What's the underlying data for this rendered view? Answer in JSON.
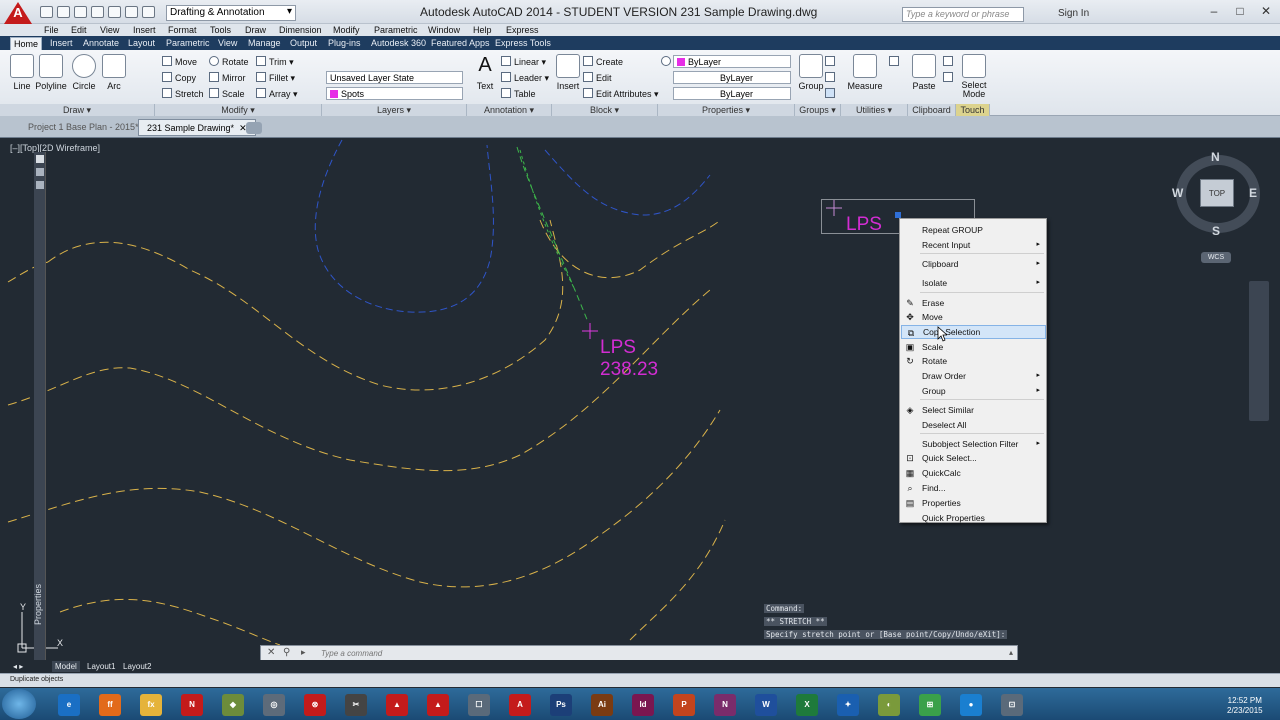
{
  "title_bar": {
    "app_logo": "A",
    "workspace": "Drafting & Annotation",
    "title": "Autodesk AutoCAD 2014 - STUDENT VERSION     231 Sample Drawing.dwg",
    "search_placeholder": "Type a keyword or phrase",
    "signin": "Sign In",
    "minimize": "–",
    "maximize": "□",
    "close": "✕"
  },
  "menu_bar": [
    "File",
    "Edit",
    "View",
    "Insert",
    "Format",
    "Tools",
    "Draw",
    "Dimension",
    "Modify",
    "Parametric",
    "Window",
    "Help",
    "Express"
  ],
  "ribbon_tabs": [
    "Home",
    "Insert",
    "Annotate",
    "Layout",
    "Parametric",
    "View",
    "Manage",
    "Output",
    "Plug-ins",
    "Autodesk 360",
    "Featured Apps",
    "Express Tools"
  ],
  "ribbon": {
    "draw": {
      "tools": [
        "Line",
        "Polyline",
        "Circle",
        "Arc"
      ],
      "title": "Draw"
    },
    "modify": {
      "tools": [
        "Move",
        "Copy",
        "Stretch",
        "Rotate",
        "Mirror",
        "Scale",
        "Trim",
        "Fillet",
        "Array"
      ],
      "title": "Modify"
    },
    "layers": {
      "state": "Unsaved Layer State",
      "layer": "Spots",
      "title": "Layers"
    },
    "annotation": {
      "big": "Text",
      "tools": [
        "Linear",
        "Leader",
        "Table"
      ],
      "title": "Annotation"
    },
    "block": {
      "big": "Insert",
      "tools": [
        "Create",
        "Edit",
        "Edit Attributes"
      ],
      "title": "Block"
    },
    "properties": {
      "color": "ByLayer",
      "linetype": "ByLayer",
      "lineweight": "ByLayer",
      "title": "Properties"
    },
    "groups": {
      "big": "Group",
      "title": "Groups"
    },
    "utilities": {
      "big": "Measure",
      "title": "Utilities"
    },
    "clipboard": {
      "big": "Paste",
      "title": "Clipboard"
    },
    "touch": {
      "big": "Select Mode",
      "title": "Touch"
    }
  },
  "file_tabs": [
    "Project 1 Base Plan - 2015*",
    "231 Sample Drawing*"
  ],
  "viewport_label": "[–][Top][2D Wireframe]",
  "palette_label": "Properties",
  "drawing": {
    "label_name": "LPS",
    "label_value": "238.23",
    "selected_label": "LPS"
  },
  "viewcube": {
    "north": "N",
    "south": "S",
    "east": "E",
    "west": "W",
    "top": "TOP",
    "wcs": "WCS"
  },
  "context_menu": [
    {
      "label": "Repeat GROUP",
      "submenu": false,
      "icon": ""
    },
    {
      "label": "Recent Input",
      "submenu": true,
      "icon": ""
    },
    {
      "label": "Clipboard",
      "submenu": true,
      "icon": ""
    },
    {
      "label": "Isolate",
      "submenu": true,
      "icon": ""
    },
    {
      "label": "Erase",
      "submenu": false,
      "icon": "eraser-icon"
    },
    {
      "label": "Move",
      "submenu": false,
      "icon": "move-icon"
    },
    {
      "label": "Copy Selection",
      "submenu": false,
      "icon": "copy-icon",
      "highlighted": true
    },
    {
      "label": "Scale",
      "submenu": false,
      "icon": "scale-icon"
    },
    {
      "label": "Rotate",
      "submenu": false,
      "icon": "rotate-icon"
    },
    {
      "label": "Draw Order",
      "submenu": true,
      "icon": ""
    },
    {
      "label": "Group",
      "submenu": true,
      "icon": ""
    },
    {
      "label": "Select Similar",
      "submenu": false,
      "icon": "select-similar-icon"
    },
    {
      "label": "Deselect All",
      "submenu": false,
      "icon": ""
    },
    {
      "label": "Subobject Selection Filter",
      "submenu": true,
      "icon": ""
    },
    {
      "label": "Quick Select...",
      "submenu": false,
      "icon": "quick-select-icon"
    },
    {
      "label": "QuickCalc",
      "submenu": false,
      "icon": "calculator-icon"
    },
    {
      "label": "Find...",
      "submenu": false,
      "icon": "find-icon"
    },
    {
      "label": "Properties",
      "submenu": false,
      "icon": "properties-icon"
    },
    {
      "label": "Quick Properties",
      "submenu": false,
      "icon": ""
    }
  ],
  "command_history": [
    "Command:",
    "** STRETCH **",
    "Specify stretch point or [Base point/Copy/Undo/eXit]:"
  ],
  "command_placeholder": "Type a command",
  "layout_tabs": [
    "Model",
    "Layout1",
    "Layout2"
  ],
  "status_text": "Duplicate objects",
  "taskbar_icons": [
    "e",
    "ff",
    "fx",
    "N",
    "◆",
    "◎",
    "⊗",
    "✂",
    "▲",
    "▲",
    "☐",
    "A",
    "Ps",
    "Ai",
    "Id",
    "P",
    "N",
    "W",
    "X",
    "✦",
    "◐",
    "⊞",
    "●",
    "⊡"
  ],
  "clock": {
    "time": "12:52 PM",
    "date": "2/23/2015"
  }
}
